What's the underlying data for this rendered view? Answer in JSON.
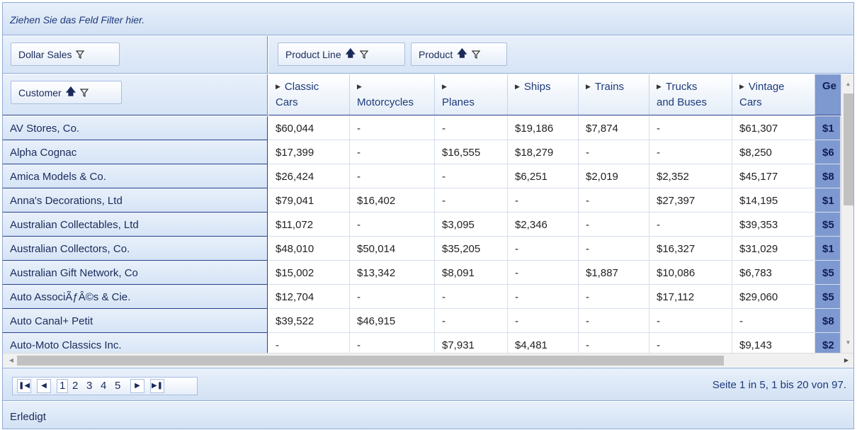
{
  "filter_zone": {
    "placeholder": "Ziehen Sie das Feld Filter hier."
  },
  "data_field": {
    "label": "Dollar Sales",
    "icon": "filter-icon"
  },
  "column_fields": [
    {
      "label": "Product Line",
      "sort": "ascending"
    },
    {
      "label": "Product",
      "sort": "ascending"
    }
  ],
  "row_field": {
    "label": "Customer",
    "sort": "ascending"
  },
  "columns": [
    {
      "label": "Classic Cars",
      "line1": "Classic",
      "line2": "Cars"
    },
    {
      "label": "Motorcycles",
      "line1": "",
      "line2": "Motorcycles"
    },
    {
      "label": "Planes",
      "line1": "",
      "line2": "Planes"
    },
    {
      "label": "Ships",
      "line1": "Ships",
      "line2": ""
    },
    {
      "label": "Trains",
      "line1": "Trains",
      "line2": ""
    },
    {
      "label": "Trucks and Buses",
      "line1": "Trucks",
      "line2": "and Buses"
    },
    {
      "label": "Vintage Cars",
      "line1": "Vintage",
      "line2": "Cars"
    },
    {
      "label": "Ge",
      "line1": "Ge",
      "line2": ""
    }
  ],
  "rows": [
    {
      "customer": "AV Stores, Co.",
      "values": [
        "$60,044",
        "-",
        "-",
        "$19,186",
        "$7,874",
        "-",
        "$61,307",
        "$1"
      ]
    },
    {
      "customer": "Alpha Cognac",
      "values": [
        "$17,399",
        "-",
        "$16,555",
        "$18,279",
        "-",
        "-",
        "$8,250",
        "$6"
      ]
    },
    {
      "customer": "Amica Models & Co.",
      "values": [
        "$26,424",
        "-",
        "-",
        "$6,251",
        "$2,019",
        "$2,352",
        "$45,177",
        "$8"
      ]
    },
    {
      "customer": "Anna's Decorations, Ltd",
      "values": [
        "$79,041",
        "$16,402",
        "-",
        "-",
        "-",
        "$27,397",
        "$14,195",
        "$1"
      ]
    },
    {
      "customer": "Australian Collectables, Ltd",
      "values": [
        "$11,072",
        "-",
        "$3,095",
        "$2,346",
        "-",
        "-",
        "$39,353",
        "$5"
      ]
    },
    {
      "customer": "Australian Collectors, Co.",
      "values": [
        "$48,010",
        "$50,014",
        "$35,205",
        "-",
        "-",
        "$16,327",
        "$31,029",
        "$1"
      ]
    },
    {
      "customer": "Australian Gift Network, Co",
      "values": [
        "$15,002",
        "$13,342",
        "$8,091",
        "-",
        "$1,887",
        "$10,086",
        "$6,783",
        "$5"
      ]
    },
    {
      "customer": "Auto AssociÃƒÂ©s & Cie.",
      "values": [
        "$12,704",
        "-",
        "-",
        "-",
        "-",
        "$17,112",
        "$29,060",
        "$5"
      ]
    },
    {
      "customer": "Auto Canal+ Petit",
      "values": [
        "$39,522",
        "$46,915",
        "-",
        "-",
        "-",
        "-",
        "-",
        "$8"
      ]
    },
    {
      "customer": "Auto-Moto Classics Inc.",
      "values": [
        "-",
        "-",
        "$7,931",
        "$4,481",
        "-",
        "-",
        "$9,143",
        "$2"
      ]
    }
  ],
  "pager": {
    "pages": [
      "1",
      "2",
      "3",
      "4",
      "5"
    ],
    "active_page": "1",
    "info": "Seite 1 in 5, 1 bis 20 von 97."
  },
  "status": {
    "text": "Erledigt"
  },
  "colors": {
    "header_bg": "#d6e4f6",
    "total_bg": "#7e99cf",
    "border": "#2b3f8a"
  }
}
